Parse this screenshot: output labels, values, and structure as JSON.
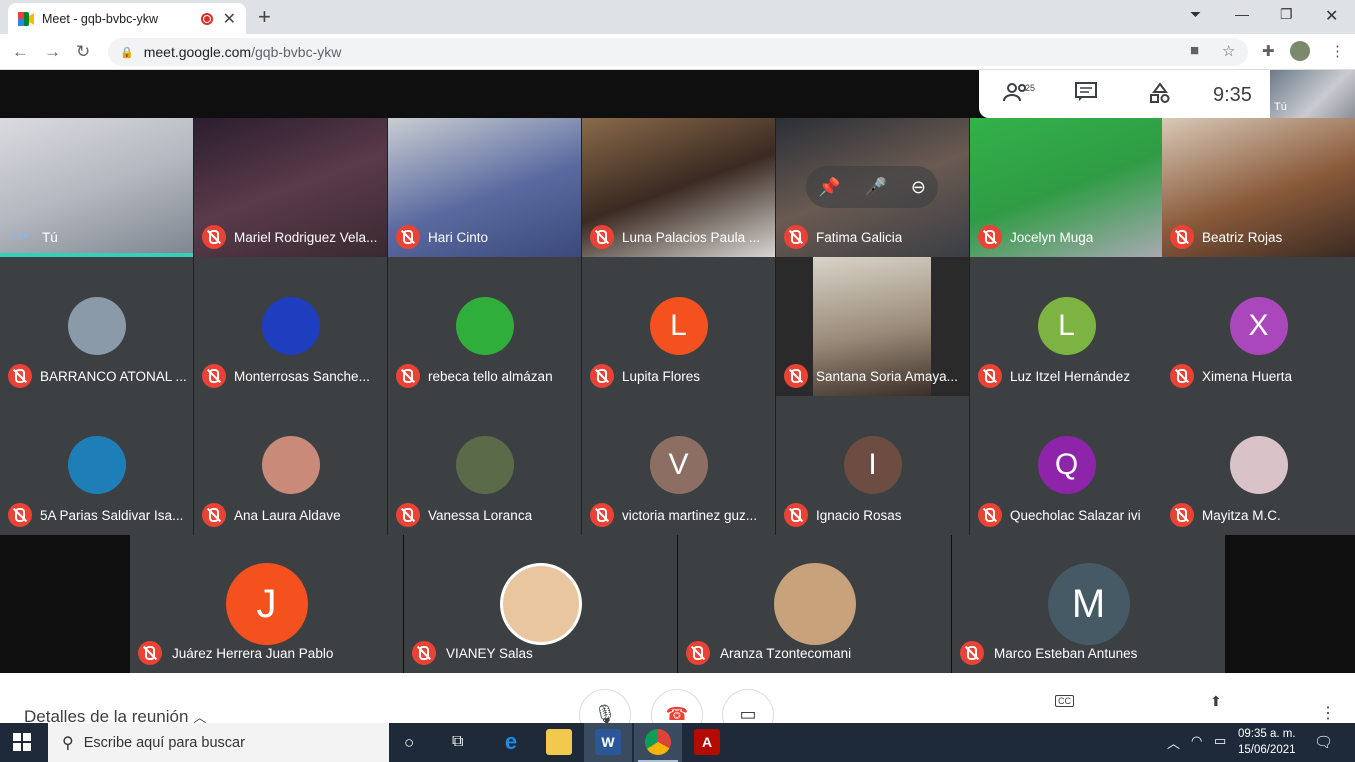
{
  "browser": {
    "tab_title": "Meet - gqb-bvbc-ykw",
    "tab_close": "✕",
    "new_tab": "+",
    "url_domain": "meet.google.com",
    "url_path": "/gqb-bvbc-ykw"
  },
  "meet_toolbar": {
    "participants_count": "25",
    "time": "9:35",
    "self_label": "Tú"
  },
  "self_tile": {
    "dots": "•••",
    "name": "Tú"
  },
  "row_a": [
    {
      "name": "Mariel Rodriguez Vela..."
    },
    {
      "name": "Hari Cinto"
    },
    {
      "name": "Luna Palacios Paula ..."
    },
    {
      "name": "Fatima Galicia"
    },
    {
      "name": "Jocelyn Muga"
    },
    {
      "name": "Beatriz Rojas"
    }
  ],
  "row_b": [
    {
      "name": "BARRANCO ATONAL ...",
      "avatar": "",
      "color": "#8a9aa8"
    },
    {
      "name": "Monterrosas Sanche...",
      "avatar": "",
      "color": "#1f3dbf"
    },
    {
      "name": "rebeca tello almázan",
      "avatar": "",
      "color": "#2fae3b"
    },
    {
      "name": "Lupita Flores",
      "avatar": "L",
      "color": "#f4511e"
    },
    {
      "name": "Santana Soria Amaya...",
      "avatar": "",
      "color": "#6d6a66"
    },
    {
      "name": "Luz Itzel Hernández",
      "avatar": "L",
      "color": "#7cb342"
    },
    {
      "name": "Ximena Huerta",
      "avatar": "X",
      "color": "#ab47bc"
    }
  ],
  "row_c": [
    {
      "name": "5A Parias Saldivar Isa...",
      "avatar": "",
      "color": "#1e7fb8"
    },
    {
      "name": "Ana Laura Aldave",
      "avatar": "",
      "color": "#c98a7a"
    },
    {
      "name": "Vanessa Loranca",
      "avatar": "",
      "color": "#5b6b4a"
    },
    {
      "name": "victoria martinez guz...",
      "avatar": "V",
      "color": "#8d6e63"
    },
    {
      "name": "Ignacio Rosas",
      "avatar": "I",
      "color": "#6d4c41"
    },
    {
      "name": "Quecholac Salazar ivi",
      "avatar": "Q",
      "color": "#8e24aa"
    },
    {
      "name": "Mayitza M.C.",
      "avatar": "",
      "color": "#d9c2c8"
    }
  ],
  "row_d": [
    {
      "name": "Juárez Herrera Juan Pablo",
      "avatar": "J",
      "color": "#f4511e"
    },
    {
      "name": "VIANEY Salas",
      "avatar": "",
      "color": "#e9c6a0"
    },
    {
      "name": "Aranza Tzontecomani",
      "avatar": "",
      "color": "#c8a27a"
    },
    {
      "name": "Marco Esteban Antunes",
      "avatar": "M",
      "color": "#455a64"
    }
  ],
  "bottom": {
    "details": "Detalles de la reunión"
  },
  "taskbar": {
    "search_placeholder": "Escribe aquí para buscar",
    "clock_time": "09:35 a. m.",
    "clock_date": "15/06/2021"
  }
}
